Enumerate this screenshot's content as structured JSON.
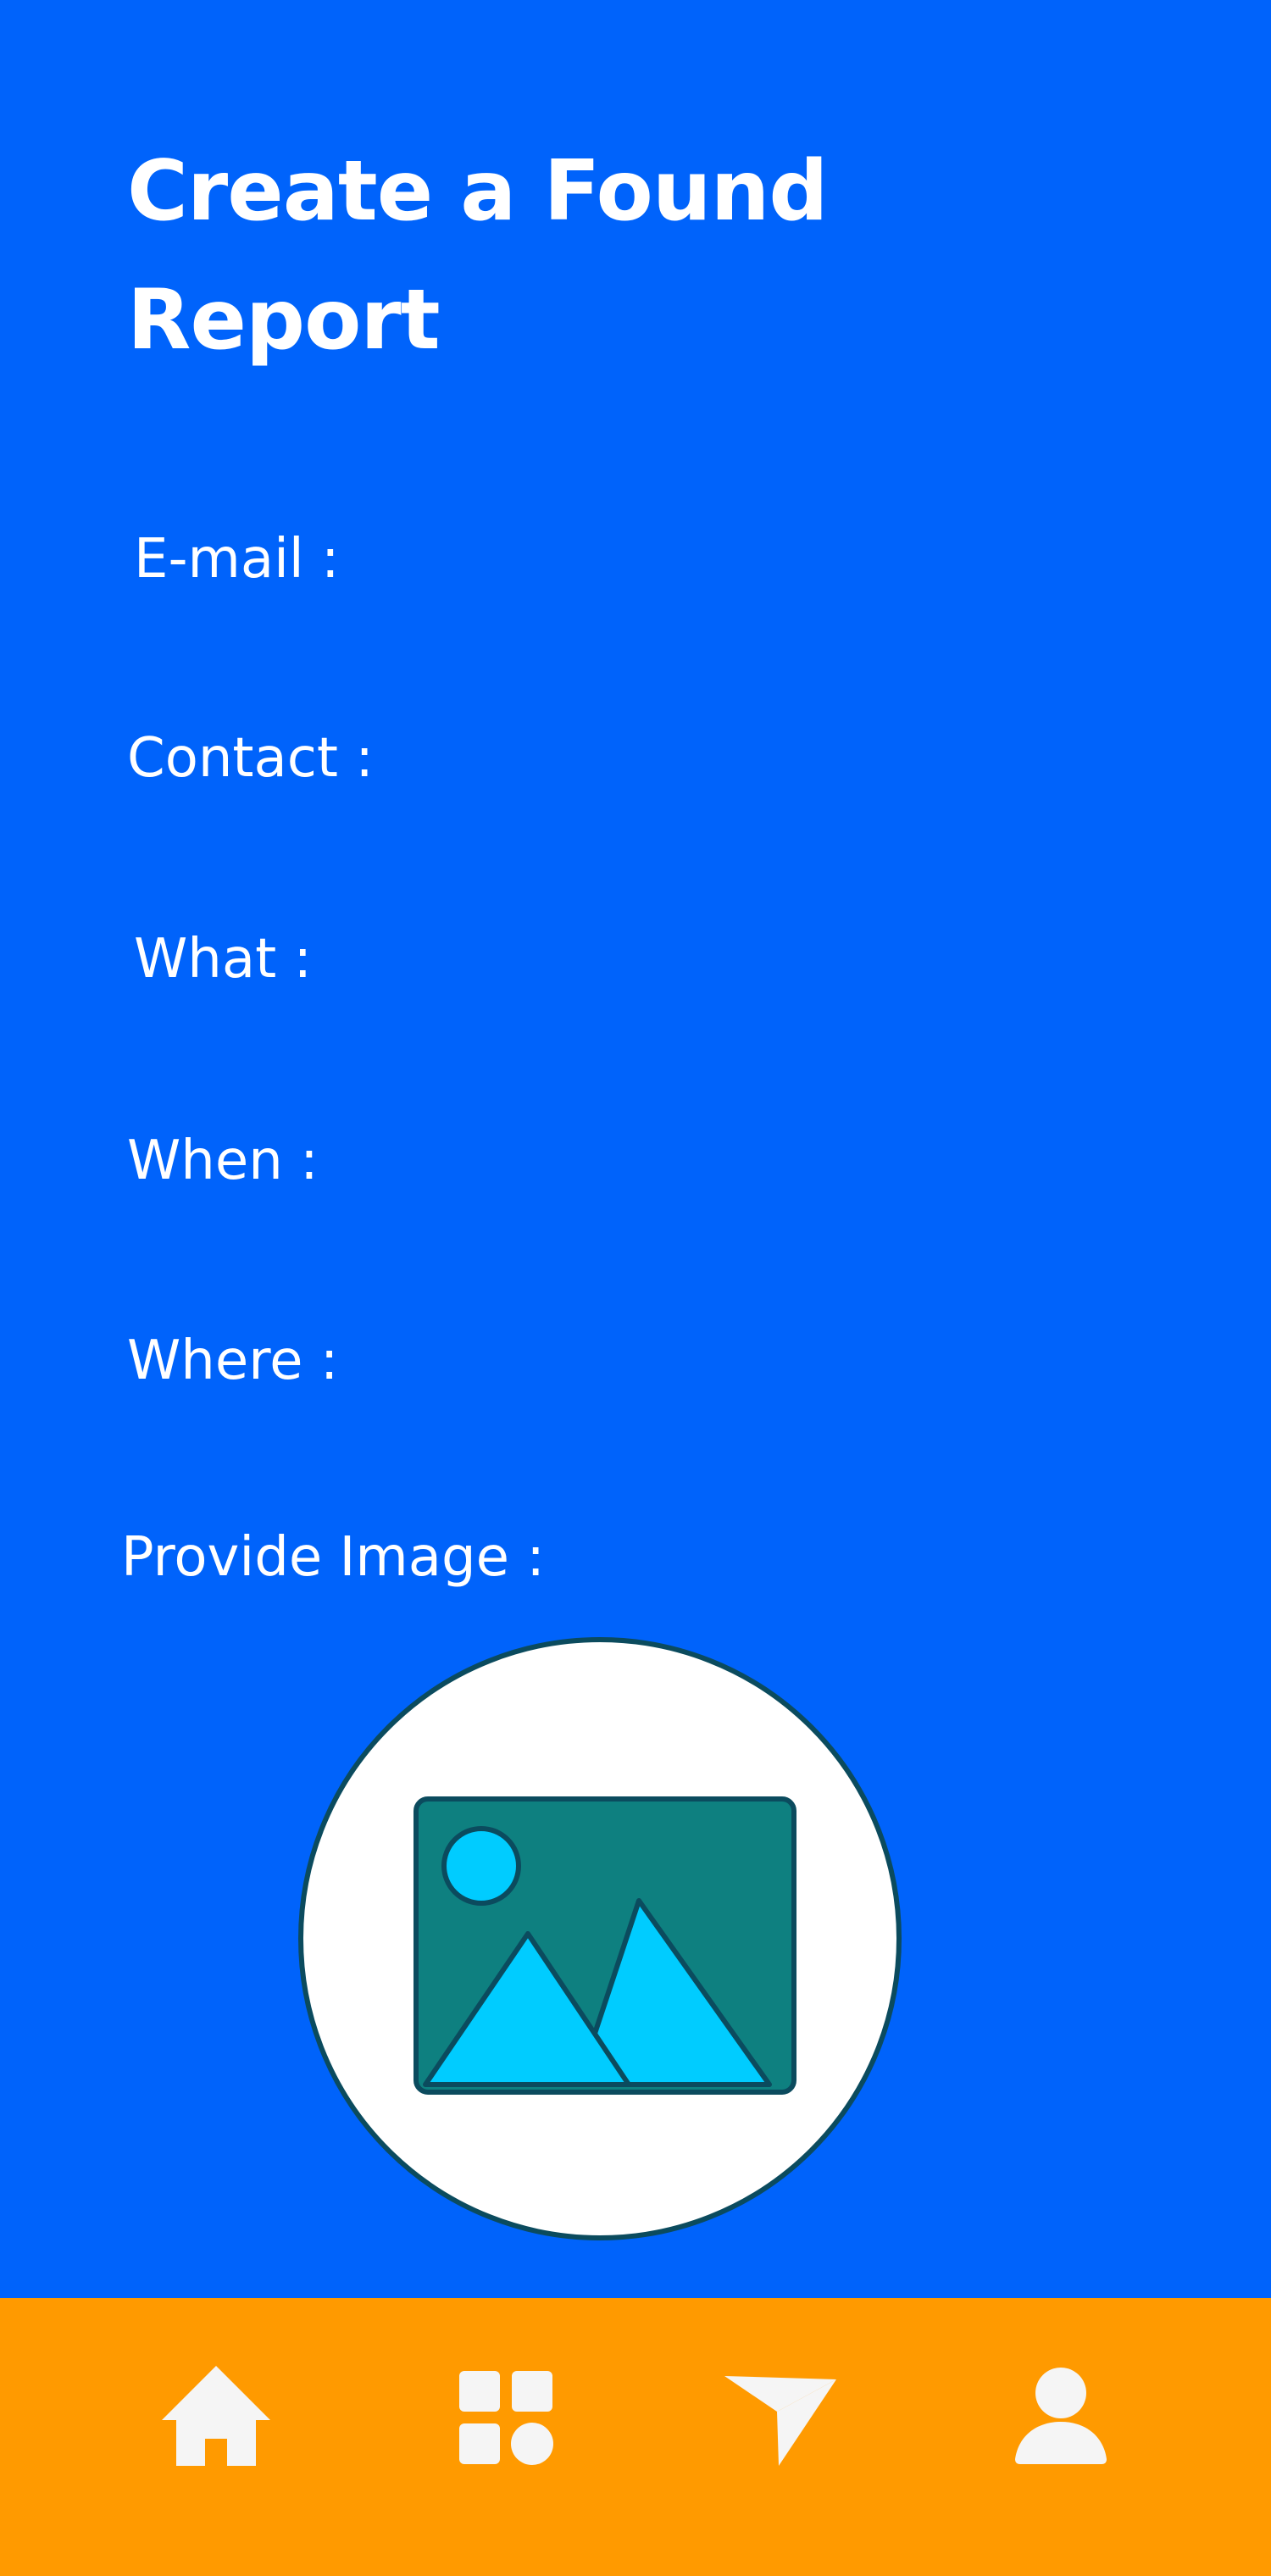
{
  "page": {
    "title": "Create a Found Report"
  },
  "form": {
    "email_label": "E-mail :",
    "contact_label": "Contact :",
    "what_label": "What :",
    "when_label": "When :",
    "where_label": "Where :",
    "image_label": "Provide Image :"
  },
  "image_upload": {
    "icon": "image-placeholder-icon"
  },
  "bottom_nav": {
    "items": [
      {
        "icon": "home-icon"
      },
      {
        "icon": "grid-apps-icon"
      },
      {
        "icon": "send-icon"
      },
      {
        "icon": "profile-icon"
      }
    ]
  },
  "colors": {
    "background": "#0063FB",
    "nav_background": "#FF9A00",
    "text": "#FFFFFF",
    "nav_icon": "#F5F5F5",
    "image_frame": "#0E8080",
    "image_accent": "#00CCFF",
    "image_outline": "#0B4B5E"
  }
}
